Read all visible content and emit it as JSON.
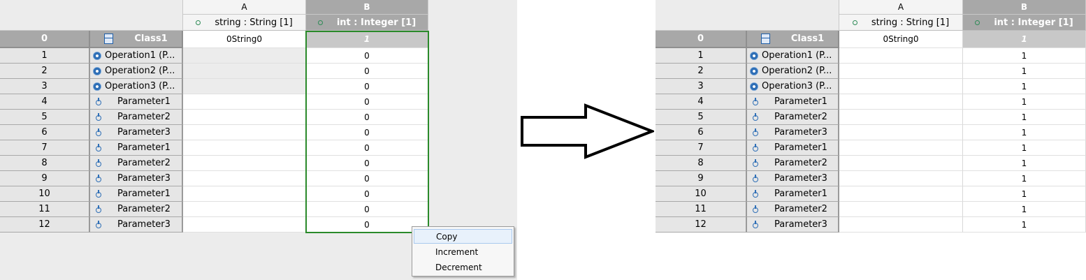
{
  "columns": [
    {
      "letter": "A",
      "property": "string : String [1]"
    },
    {
      "letter": "B",
      "property": "int : Integer [1]"
    }
  ],
  "header_row": {
    "num": "0",
    "element": "Class1",
    "value_a": "0String0",
    "value_b": "1"
  },
  "rows": [
    {
      "num": "1",
      "element": "Operation1 (P...",
      "kind": "operation"
    },
    {
      "num": "2",
      "element": "Operation2 (P...",
      "kind": "operation"
    },
    {
      "num": "3",
      "element": "Operation3 (P...",
      "kind": "operation"
    },
    {
      "num": "4",
      "element": "Parameter1",
      "kind": "parameter"
    },
    {
      "num": "5",
      "element": "Parameter2",
      "kind": "parameter"
    },
    {
      "num": "6",
      "element": "Parameter3",
      "kind": "parameter"
    },
    {
      "num": "7",
      "element": "Parameter1",
      "kind": "parameter"
    },
    {
      "num": "8",
      "element": "Parameter2",
      "kind": "parameter"
    },
    {
      "num": "9",
      "element": "Parameter3",
      "kind": "parameter"
    },
    {
      "num": "10",
      "element": "Parameter1",
      "kind": "parameter"
    },
    {
      "num": "11",
      "element": "Parameter2",
      "kind": "parameter"
    },
    {
      "num": "12",
      "element": "Parameter3",
      "kind": "parameter"
    }
  ],
  "before_values_b": [
    "0",
    "0",
    "0",
    "0",
    "0",
    "0",
    "0",
    "0",
    "0",
    "0",
    "0",
    "0"
  ],
  "after_values_b": [
    "1",
    "1",
    "1",
    "1",
    "1",
    "1",
    "1",
    "1",
    "1",
    "1",
    "1",
    "1"
  ],
  "context_menu": {
    "items": [
      "Copy",
      "Increment",
      "Decrement"
    ],
    "highlighted": "Copy"
  },
  "icons": {
    "class": "class-icon",
    "operation": "operation-gear-icon",
    "parameter": "parameter-icon",
    "property": "property-dot-icon",
    "transition": "right-arrow-icon"
  },
  "colors": {
    "selection_border": "#2a8a2a",
    "header_selected": "#a8a8a8",
    "icon_blue": "#2f6fb6",
    "menu_highlight": "#e8f1fb"
  }
}
